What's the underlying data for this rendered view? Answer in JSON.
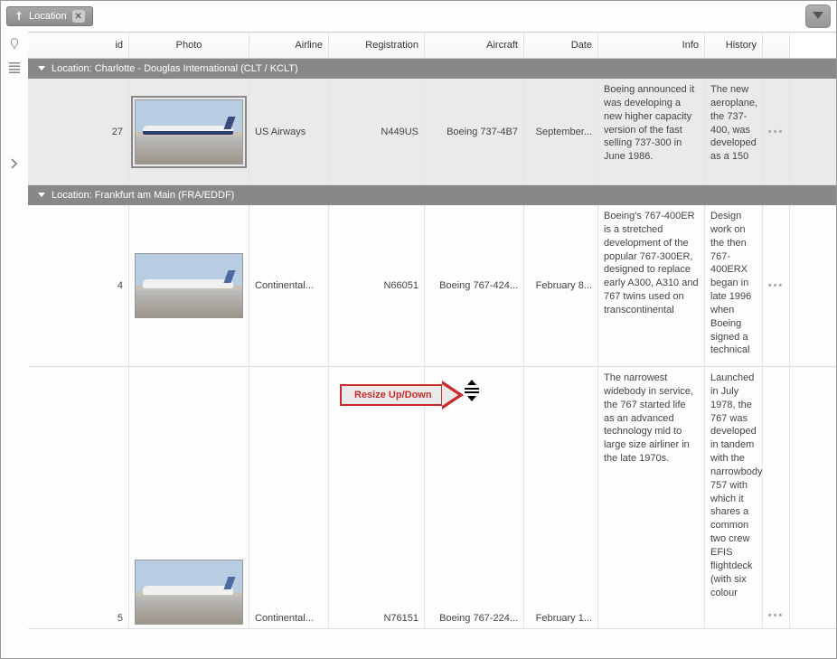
{
  "toolbar": {
    "group_chip_label": "Location"
  },
  "headers": {
    "id": "id",
    "photo": "Photo",
    "airline": "Airline",
    "registration": "Registration",
    "aircraft": "Aircraft",
    "date": "Date",
    "info": "Info",
    "history": "History"
  },
  "groups": [
    {
      "title": "Location: Charlotte - Douglas International (CLT / KCLT)",
      "rows": [
        {
          "id": "27",
          "airline": "US Airways",
          "registration": "N449US",
          "aircraft": "Boeing 737-4B7",
          "date": "September...",
          "info": "Boeing announced it was developing a new higher capacity version of the fast selling 737-300 in June 1986.",
          "history": "The new aeroplane, the 737-400, was developed as a 150",
          "selected": true
        }
      ]
    },
    {
      "title": "Location: Frankfurt am Main (FRA/EDDF)",
      "rows": [
        {
          "id": "4",
          "airline": "Continental...",
          "registration": "N66051",
          "aircraft": "Boeing 767-424...",
          "date": "February 8...",
          "info": "Boeing's 767-400ER is a stretched development of the popular 767-300ER, designed to replace early A300, A310 and 767 twins used on transcontinental",
          "history": "Design work on the then 767-400ERX began in late 1996 when Boeing signed a technical",
          "selected": false
        },
        {
          "id": "5",
          "airline": "Continental...",
          "registration": "N76151",
          "aircraft": "Boeing 767-224...",
          "date": "February 1...",
          "info": "The narrowest widebody in service, the 767 started life as an advanced technology mid to large size airliner in the late 1970s.",
          "history": "Launched in July 1978, the 767 was developed in tandem with the narrowbody 757 with which it shares a common two crew EFIS flightdeck (with six colour",
          "selected": false
        }
      ]
    }
  ],
  "annotation": {
    "label": "Resize Up/Down"
  }
}
